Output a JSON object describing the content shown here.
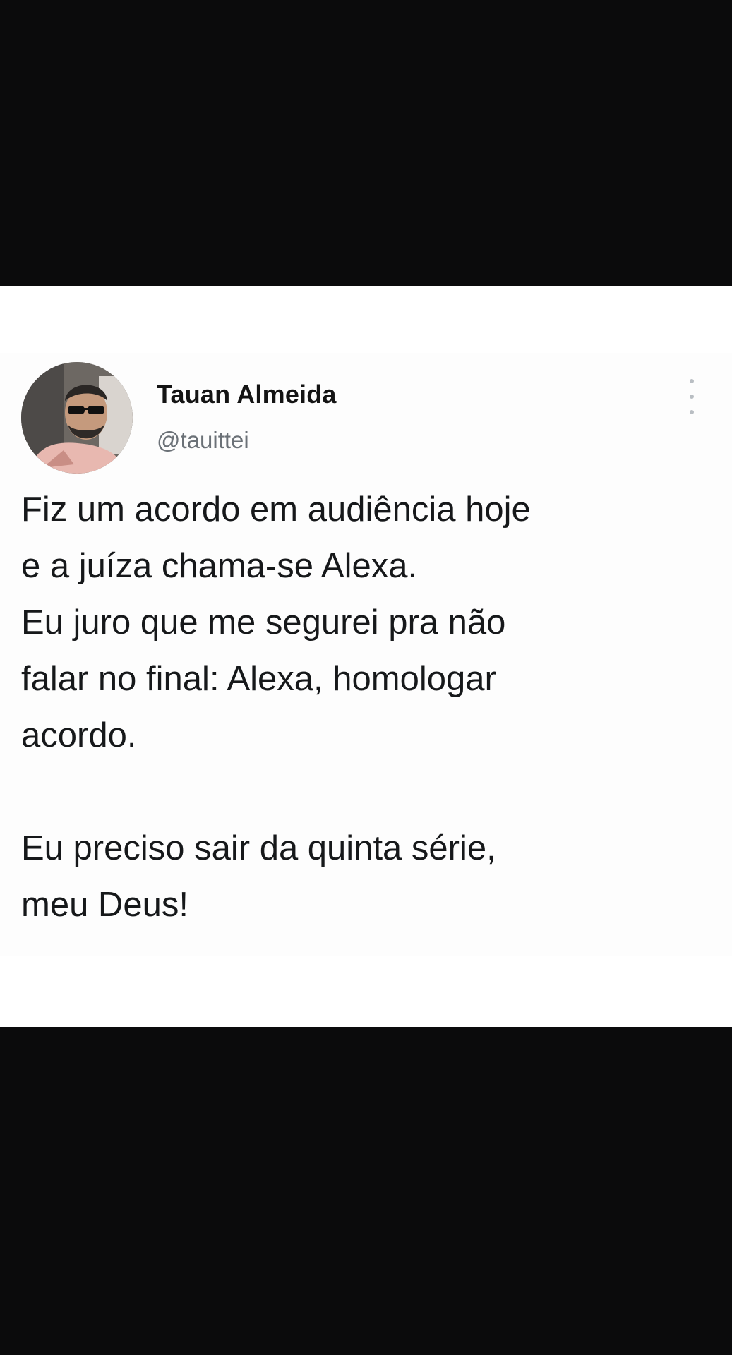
{
  "tweet": {
    "author": {
      "name": "Tauan Almeida",
      "handle": "@tauittei",
      "avatar": "profile-photo-man-sunglasses"
    },
    "menu_icon": "more-vertical-icon",
    "text_lines": [
      "Fiz um acordo em audiência hoje",
      "e a juíza chama-se Alexa.",
      "Eu juro que me segurei pra não",
      "falar no final: Alexa, homologar",
      "acordo.",
      "",
      "Eu preciso sair da quinta série,",
      "meu Deus!"
    ]
  },
  "colors": {
    "background": "#0b0b0c",
    "card": "#ffffff",
    "text": "#16181a",
    "handle": "#6b7177"
  }
}
